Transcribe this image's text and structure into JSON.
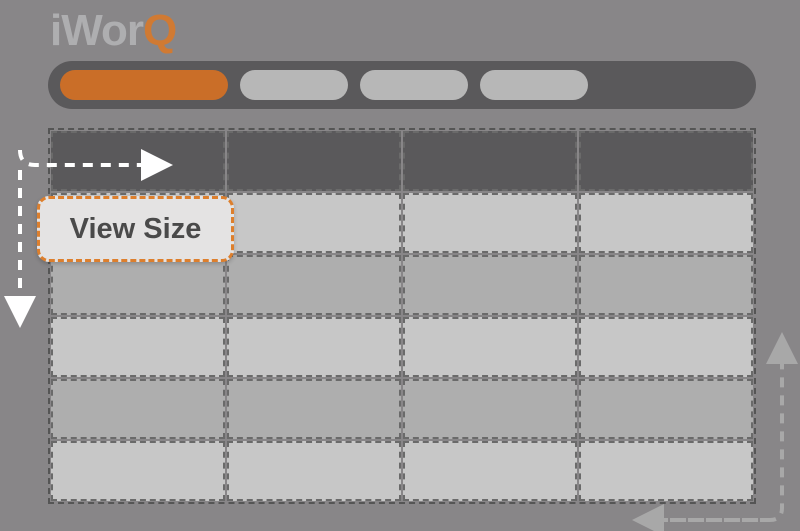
{
  "logo": {
    "prefix": "iWor",
    "accent": "Q"
  },
  "tabs": {
    "active": "",
    "inactive1": "",
    "inactive2": "",
    "inactive3": ""
  },
  "callout": {
    "label": "View Size"
  }
}
